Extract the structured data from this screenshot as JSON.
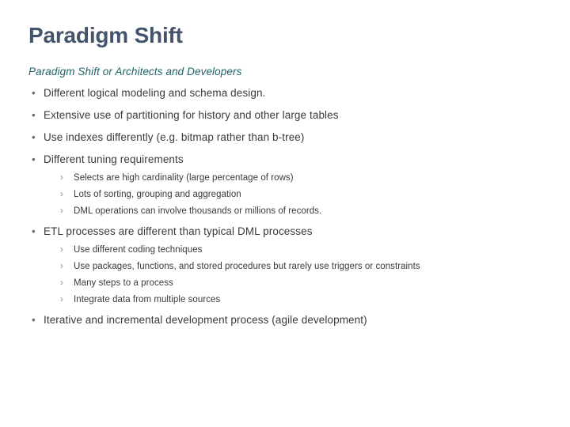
{
  "slide": {
    "title": "Paradigm Shift",
    "subtitle": "Paradigm Shift or Architects and Developers",
    "bullet_marker": "•",
    "sub_bullet_marker": "›",
    "colors": {
      "title": "#44546A",
      "subtitle": "#1F6368",
      "body_text": "#3A3A3A",
      "bullet_marker": "#6B6B6B",
      "sub_bullet_marker": "#8D8D8D",
      "background": "#FFFFFF"
    },
    "content": [
      {
        "text": "Different logical modeling and schema design.",
        "sub_items": []
      },
      {
        "text": "Extensive use of partitioning for history and other large tables",
        "sub_items": []
      },
      {
        "text": "Use indexes differently (e.g. bitmap rather than b-tree)",
        "sub_items": []
      },
      {
        "text": "Different tuning requirements",
        "sub_items": [
          "Selects are high cardinality (large percentage of rows)",
          "Lots of sorting, grouping and aggregation",
          "DML operations can involve thousands or millions of records."
        ]
      },
      {
        "text": "ETL processes are different than typical DML processes",
        "sub_items": [
          "Use different coding techniques",
          "Use packages, functions, and stored procedures but rarely use triggers or constraints",
          "Many steps to a process",
          "Integrate data from multiple sources"
        ]
      },
      {
        "text": "Iterative and incremental development process (agile development)",
        "sub_items": []
      }
    ]
  }
}
